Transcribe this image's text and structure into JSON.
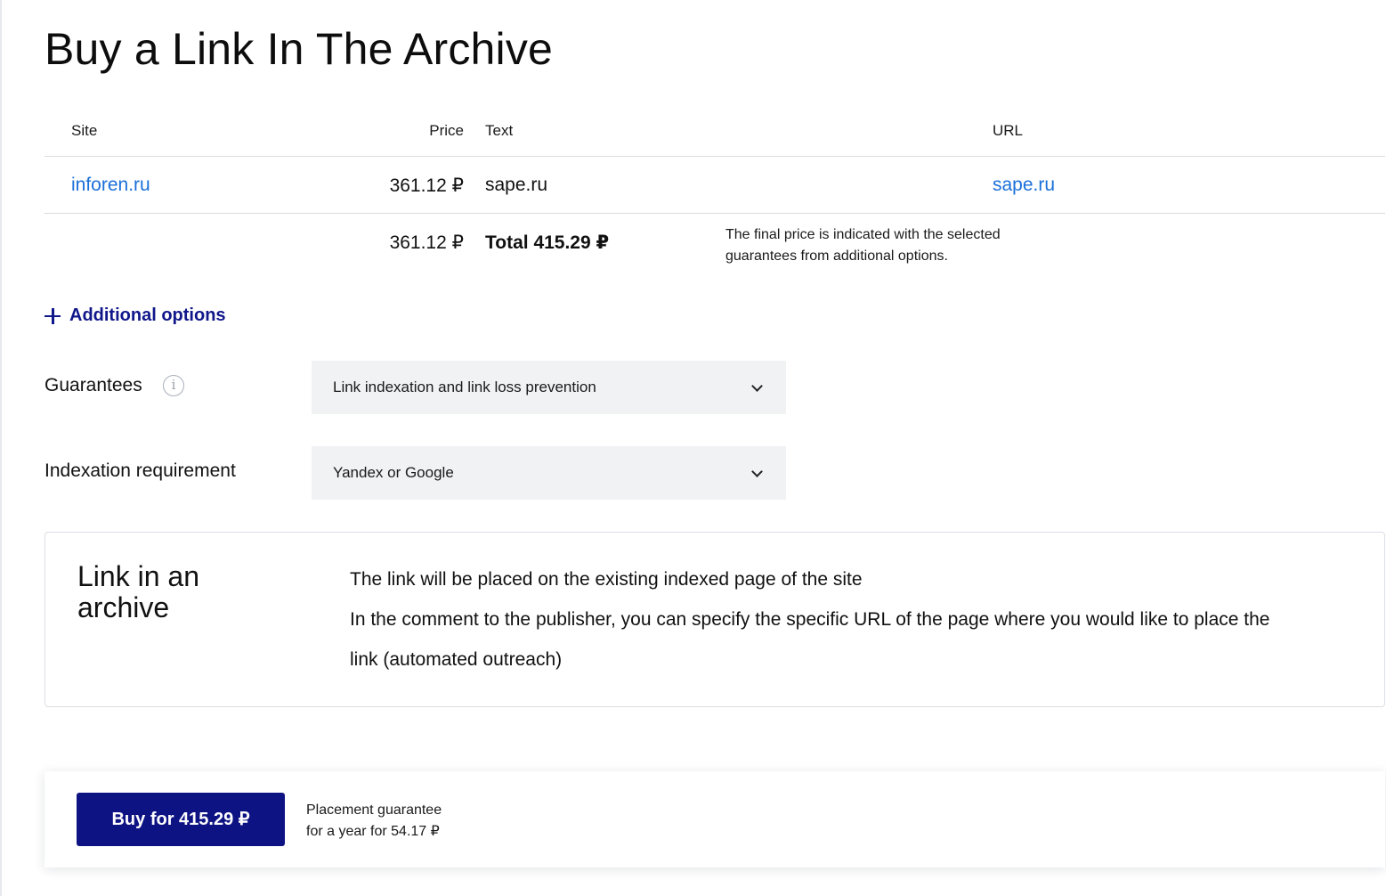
{
  "page": {
    "title": "Buy a Link In The Archive"
  },
  "table": {
    "columns": {
      "site": "Site",
      "price": "Price",
      "text": "Text",
      "url": "URL"
    },
    "rows": [
      {
        "site": "inforen.ru",
        "price": "361.12 ₽",
        "text": "sape.ru",
        "url": "sape.ru"
      }
    ],
    "totals": {
      "price": "361.12 ₽",
      "total": "Total 415.29 ₽",
      "note_line1": "The final price is indicated with the selected",
      "note_line2": "guarantees from additional options."
    }
  },
  "options": {
    "toggle_label": "Additional options",
    "guarantees": {
      "label": "Guarantees",
      "info_icon": "i",
      "value": "Link indexation and link loss prevention"
    },
    "indexation": {
      "label": "Indexation requirement",
      "value": "Yandex or Google"
    }
  },
  "description": {
    "title": "Link in an archive",
    "lines": [
      "The link will be placed on the existing indexed page of the site",
      "In the comment to the publisher, you can specify the specific URL of the page where you would like to place the",
      "link (automated outreach)"
    ]
  },
  "purchase": {
    "button_label": "Buy for 415.29 ₽",
    "guarantee_line1": "Placement guarantee",
    "guarantee_line2": "for a year for 54.17 ₽"
  },
  "colors": {
    "accent": "#0e1383",
    "link": "#1a6fd9",
    "select_bg": "#f1f2f4"
  }
}
